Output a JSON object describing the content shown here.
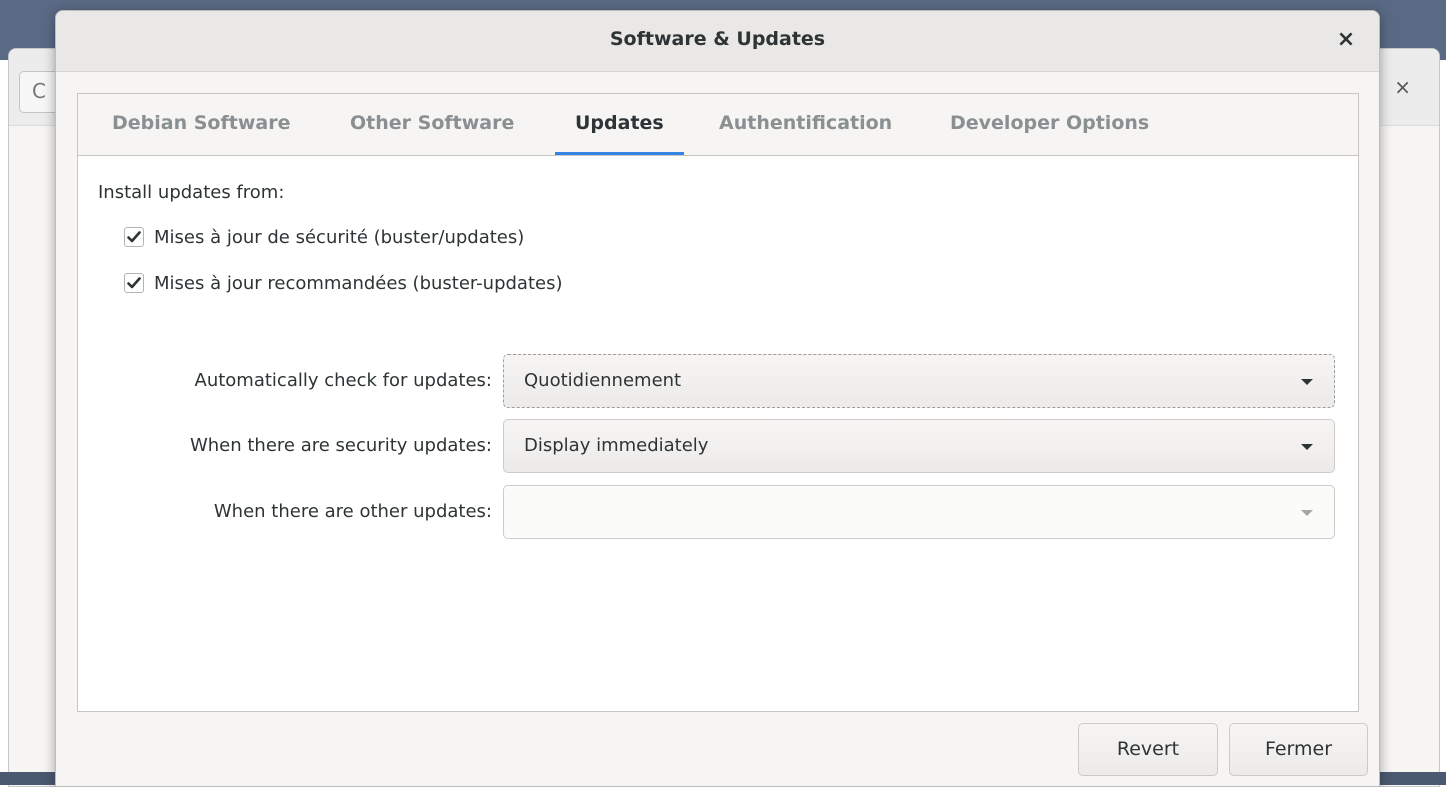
{
  "background_app": {
    "refresh_glyph": "C",
    "close_glyph": "×"
  },
  "dialog": {
    "title": "Software & Updates",
    "close_glyph": "×"
  },
  "tabs": [
    {
      "label": "Debian Software",
      "active": false
    },
    {
      "label": "Other Software",
      "active": false
    },
    {
      "label": "Updates",
      "active": true
    },
    {
      "label": "Authentification",
      "active": false
    },
    {
      "label": "Developer Options",
      "active": false
    }
  ],
  "updates": {
    "install_from_label": "Install updates from:",
    "sources": [
      {
        "label": "Mises à jour de sécurité (buster/updates)",
        "checked": true
      },
      {
        "label": "Mises à jour recommandées (buster-updates)",
        "checked": true
      }
    ],
    "auto_check": {
      "label": "Automatically check for updates:",
      "value": "Quotidiennement"
    },
    "security_updates": {
      "label": "When there are security updates:",
      "value": "Display immediately"
    },
    "other_updates": {
      "label": "When there are other updates:",
      "value": ""
    }
  },
  "buttons": {
    "revert": "Revert",
    "close": "Fermer"
  },
  "colors": {
    "accent": "#3584e4",
    "text": "#2e3436",
    "inactive_tab": "#8a8f91"
  }
}
